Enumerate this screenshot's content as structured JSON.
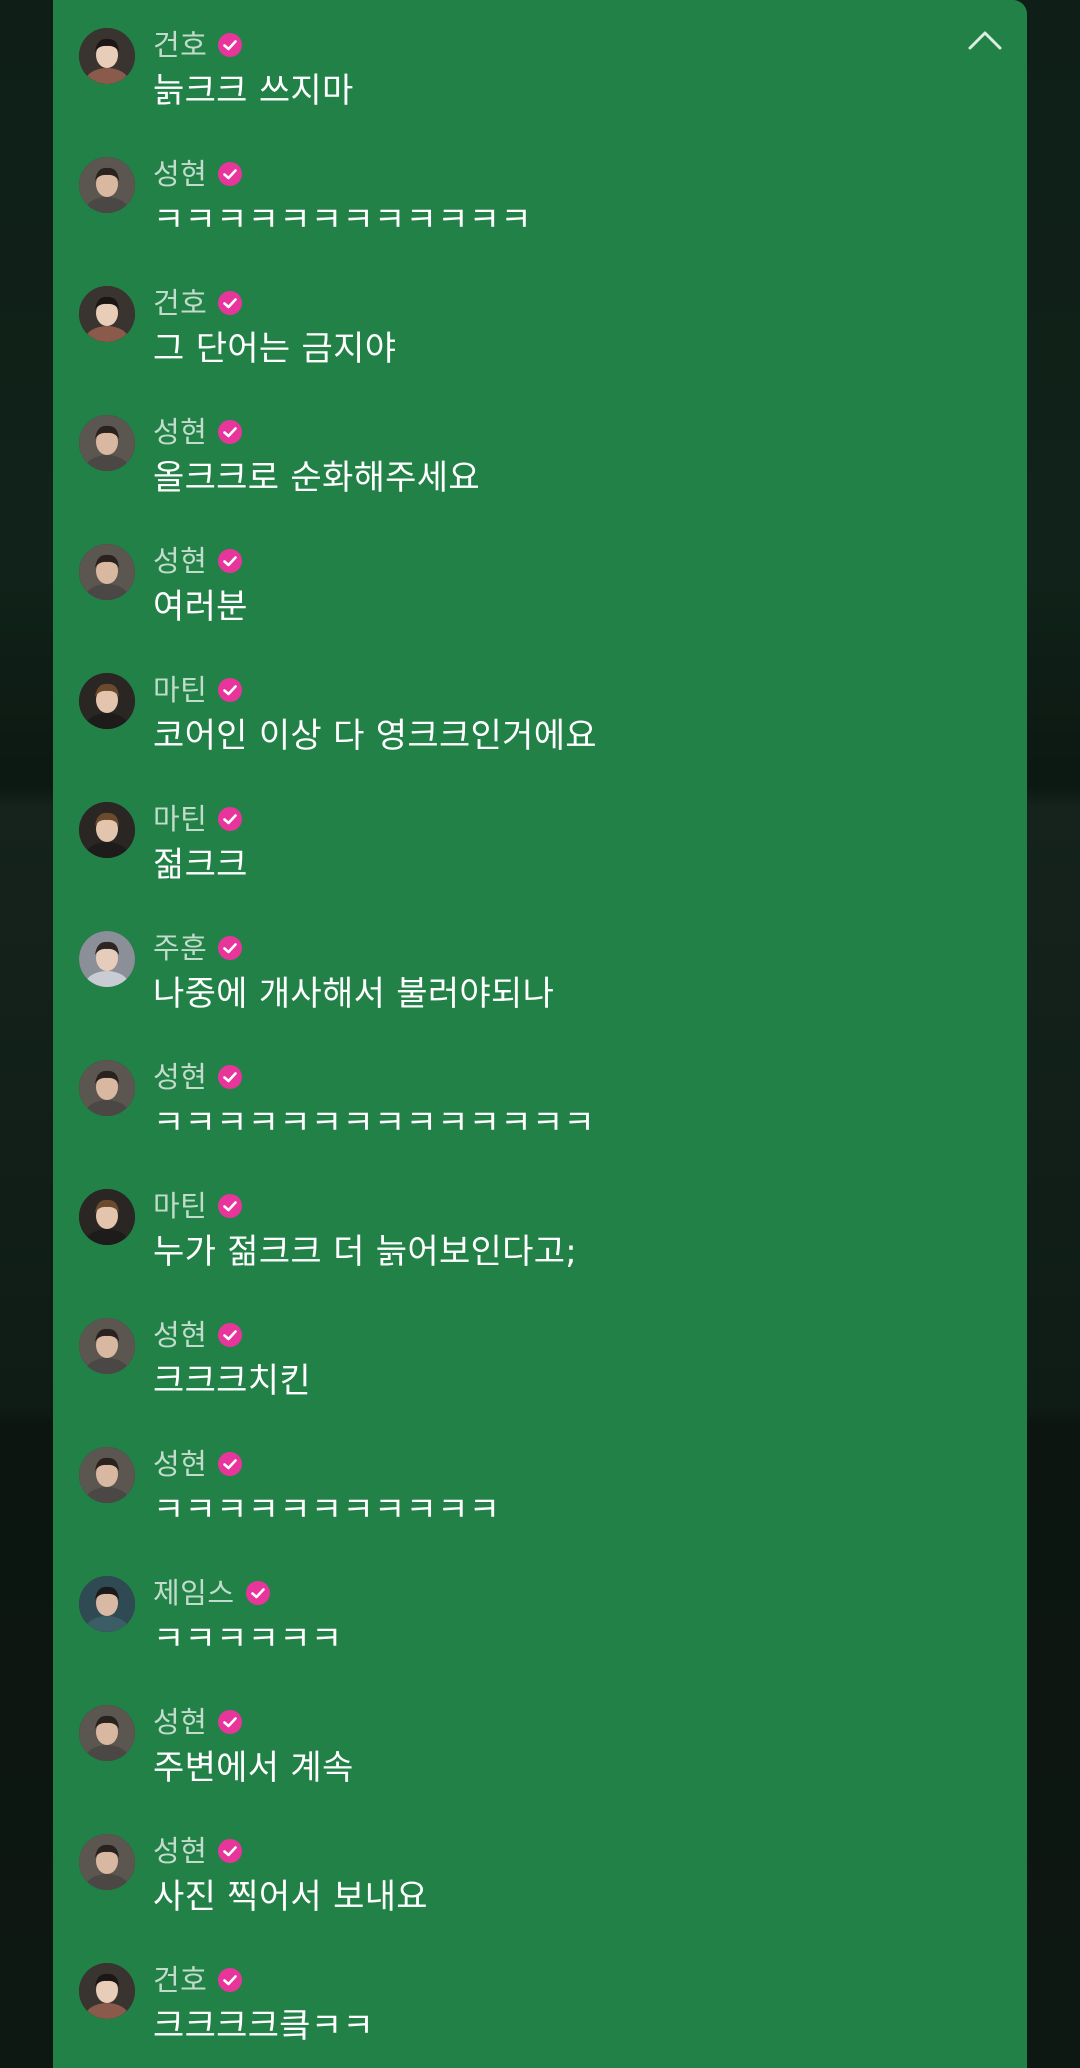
{
  "chat": {
    "collapse_icon": "chevron-up-icon",
    "accent_color": "#228147",
    "badge_color": "#e8359c",
    "messages": [
      {
        "name": "건호",
        "text": "늙크크 쓰지마",
        "avatar": "gunho"
      },
      {
        "name": "성현",
        "text": "ㅋㅋㅋㅋㅋㅋㅋㅋㅋㅋㅋㅋ",
        "avatar": "sunghyun"
      },
      {
        "name": "건호",
        "text": "그 단어는 금지야",
        "avatar": "gunho"
      },
      {
        "name": "성현",
        "text": "올크크로 순화해주세요",
        "avatar": "sunghyun"
      },
      {
        "name": "성현",
        "text": "여러분",
        "avatar": "sunghyun"
      },
      {
        "name": "마틴",
        "text": "코어인 이상 다 영크크인거에요",
        "avatar": "martin"
      },
      {
        "name": "마틴",
        "text": "젊크크",
        "avatar": "martin"
      },
      {
        "name": "주훈",
        "text": "나중에 개사해서 불러야되나",
        "avatar": "juhoon"
      },
      {
        "name": "성현",
        "text": "ㅋㅋㅋㅋㅋㅋㅋㅋㅋㅋㅋㅋㅋㅋ",
        "avatar": "sunghyun"
      },
      {
        "name": "마틴",
        "text": "누가 젊크크 더 늙어보인다고;",
        "avatar": "martin"
      },
      {
        "name": "성현",
        "text": "크크크치킨",
        "avatar": "sunghyun"
      },
      {
        "name": "성현",
        "text": "ㅋㅋㅋㅋㅋㅋㅋㅋㅋㅋㅋ",
        "avatar": "sunghyun"
      },
      {
        "name": "제임스",
        "text": "ㅋㅋㅋㅋㅋㅋ",
        "avatar": "james"
      },
      {
        "name": "성현",
        "text": "주변에서 계속",
        "avatar": "sunghyun"
      },
      {
        "name": "성현",
        "text": "사진 찍어서 보내요",
        "avatar": "sunghyun"
      },
      {
        "name": "건호",
        "text": "크크크크킄ㅋㅋ",
        "avatar": "gunho"
      }
    ]
  }
}
